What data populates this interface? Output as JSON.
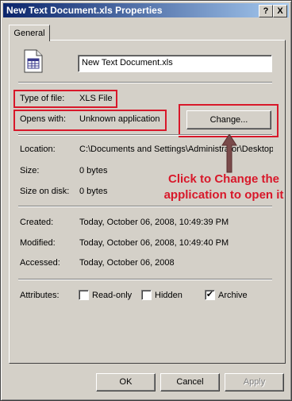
{
  "window": {
    "title": "New Text Document.xls Properties"
  },
  "titlebar_buttons": {
    "help": "?",
    "close": "X"
  },
  "tabs": [
    {
      "label": "General"
    }
  ],
  "file": {
    "name": "New Text Document.xls",
    "type_label": "Type of file:",
    "type_value": "XLS File",
    "opens_label": "Opens with:",
    "opens_value": "Unknown application",
    "change_button": "Change..."
  },
  "info": {
    "location_label": "Location:",
    "location_value": "C:\\Documents and Settings\\Administrator\\Desktop",
    "size_label": "Size:",
    "size_value": "0 bytes",
    "size_on_disk_label": "Size on disk:",
    "size_on_disk_value": "0 bytes"
  },
  "dates": {
    "created_label": "Created:",
    "created_value": "Today, October 06, 2008, 10:49:39 PM",
    "modified_label": "Modified:",
    "modified_value": "Today, October 06, 2008, 10:49:40 PM",
    "accessed_label": "Accessed:",
    "accessed_value": "Today, October 06, 2008"
  },
  "attributes": {
    "label": "Attributes:",
    "readonly": {
      "label": "Read-only",
      "checked": false
    },
    "hidden": {
      "label": "Hidden",
      "checked": false
    },
    "archive": {
      "label": "Archive",
      "checked": true,
      "mark": "✔"
    }
  },
  "annotation": {
    "line1": "Click to Change the",
    "line2": "application to open it",
    "color": "#d8182a"
  },
  "footer": {
    "ok": "OK",
    "cancel": "Cancel",
    "apply": "Apply"
  },
  "colors": {
    "title_start": "#0a246a",
    "title_end": "#a6caf0",
    "face": "#d4d0c8",
    "highlight": "#d8182a"
  }
}
